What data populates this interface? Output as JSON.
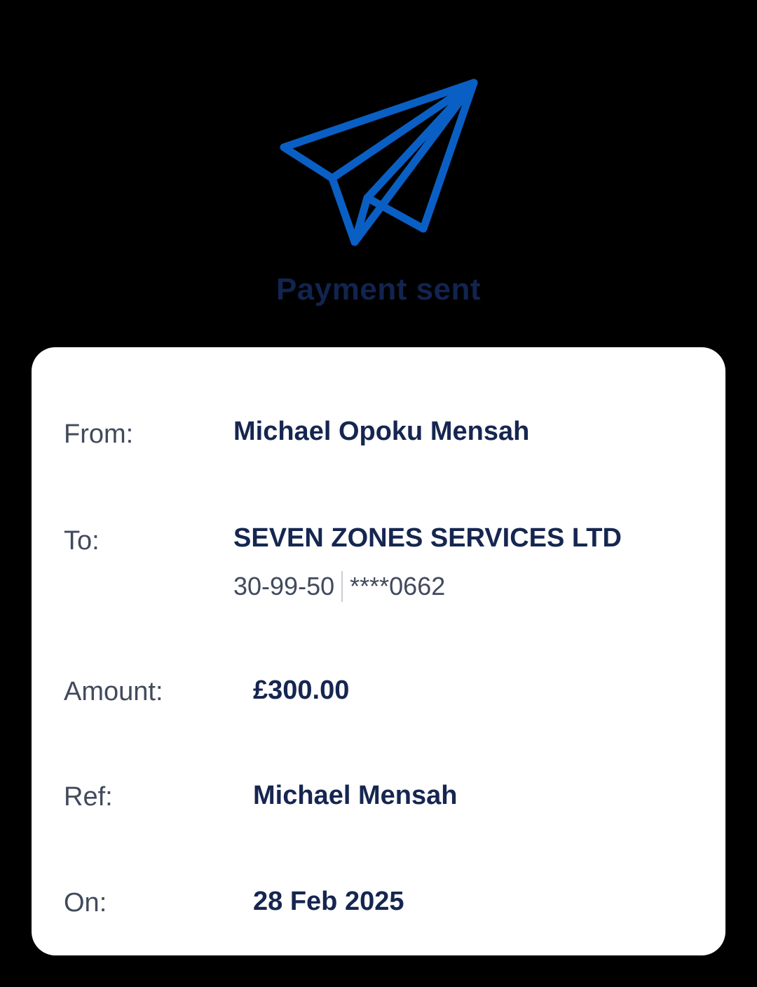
{
  "header": {
    "title": "Payment sent",
    "icon": "paper-plane-icon"
  },
  "colors": {
    "background": "#000000",
    "accent": "#0a5fc4",
    "title": "#12244f",
    "card": "#ffffff",
    "label": "#414a5c",
    "value": "#152650"
  },
  "details": {
    "from": {
      "label": "From:",
      "value": "Michael Opoku Mensah"
    },
    "to": {
      "label": "To:",
      "value": "SEVEN ZONES SERVICES LTD",
      "sort_code": "30-99-50",
      "account": "****0662"
    },
    "amount": {
      "label": "Amount:",
      "value": "£300.00"
    },
    "ref": {
      "label": "Ref:",
      "value": "Michael Mensah"
    },
    "on": {
      "label": "On:",
      "value": "28 Feb 2025"
    }
  }
}
